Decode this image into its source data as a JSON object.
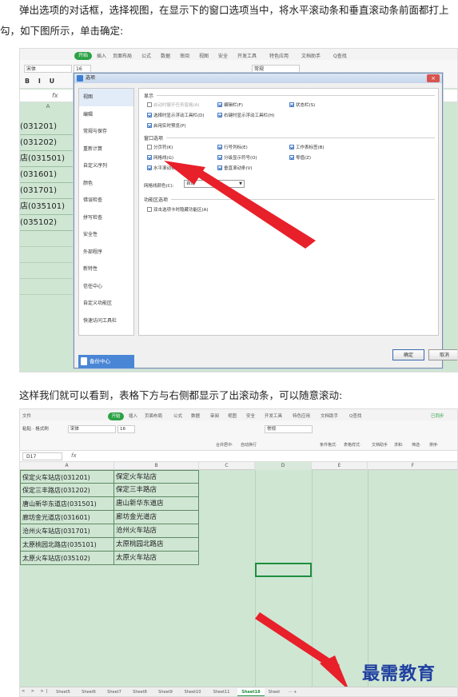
{
  "article": {
    "para1_line1": "弹出选项的对话框，选择视图，在显示下的窗口选项当中，将水平滚动条和垂直滚动条前面都打上",
    "para1_line2": "勾，如下图所示，单击确定:",
    "para2": "这样我们就可以看到，表格下方与右侧都显示了出滚动条，可以随意滚动:"
  },
  "shot1": {
    "menu": [
      "开始",
      "插入",
      "页面布局",
      "公式",
      "数据",
      "审阅",
      "视图",
      "安全",
      "开发工具",
      "特色应用",
      "文档助手",
      "Q查找"
    ],
    "font_name": "宋体",
    "font_size": "16",
    "style_select": "常规",
    "column_a": "A",
    "fx": "fx",
    "cells": [
      "(031201)",
      "(031202)",
      "店(031501)",
      "(031601)",
      "(031701)",
      "店(035101)",
      "(035102)"
    ],
    "dialog": {
      "title": "选项",
      "close": "×",
      "nav": [
        "视图",
        "编辑",
        "常规与保存",
        "重新计算",
        "自定义序列",
        "颜色",
        "错误检查",
        "拼写检查",
        "安全性",
        "外部程序",
        "新特性",
        "信任中心",
        "自定义功能区",
        "快速访问工具栏"
      ],
      "backup": "备份中心",
      "section_display": "显示",
      "opt_startup_taskpane": "启动时展开任务窗格(A)",
      "opt_formula_bar": "编辑栏(F)",
      "opt_status_bar": "状态栏(S)",
      "opt_float_toolbar_select": "选择时显示浮动工具栏(D)",
      "opt_float_toolbar_rightclick": "右键时显示浮动工具栏(H)",
      "opt_live_preview": "启用实时预览(P)",
      "section_window": "窗口选项",
      "opt_page_break": "分页符(K)",
      "opt_row_col_headers": "行号列标(E)",
      "opt_sheet_tabs": "工作表标签(B)",
      "opt_gridlines": "网格线(G)",
      "opt_outline_symbols": "分级显示符号(O)",
      "opt_zero_values": "零值(Z)",
      "opt_hscroll": "水平滚动条(T)",
      "opt_vscroll": "垂直滚动条(V)",
      "gridline_color_label": "网格线颜色(C):",
      "gridline_color_value": "自动",
      "section_ribbon": "功能区选项",
      "opt_dblclick_ribbon": "双击选项卡时隐藏功能区(A)",
      "ok": "确定",
      "cancel": "取消"
    }
  },
  "shot2": {
    "menu": [
      "文件",
      "开始",
      "插入",
      "页面布局",
      "公式",
      "数据",
      "审阅",
      "视图",
      "安全",
      "开发工具",
      "特色应用",
      "文档助手",
      "Q查找",
      "已同步"
    ],
    "paste_label": "粘贴 · 格式刷",
    "font_name": "宋体",
    "font_size": "16",
    "style_select": "常规",
    "ribbon_labels": [
      "合并居中·",
      "自动换行",
      "条件格式·",
      "表格样式·",
      "文档助手",
      "求和·",
      "筛选·",
      "排序·"
    ],
    "name_box": "D17",
    "fx": "fx",
    "columns": [
      "A",
      "B",
      "C",
      "D",
      "E",
      "F"
    ],
    "rows": [
      {
        "a": "保定火车站店(031201)",
        "b": "保定火车站店"
      },
      {
        "a": "保定三丰路店(031202)",
        "b": "保定三丰路店"
      },
      {
        "a": "唐山新华东道店(031501)",
        "b": "唐山新华东道店"
      },
      {
        "a": "廊坊金光道店(031601)",
        "b": "廊坊金光道店"
      },
      {
        "a": "沧州火车站店(031701)",
        "b": "沧州火车站店"
      },
      {
        "a": "太原桃园北路店(035101)",
        "b": "太原桃园北路店"
      },
      {
        "a": "太原火车站店(035102)",
        "b": "太原火车站店"
      }
    ],
    "sheet_nav": "< > >|",
    "sheets": [
      "Sheet5",
      "Sheet6",
      "Sheet7",
      "Sheet8",
      "Sheet9",
      "Sheet10",
      "Sheet11",
      "Sheet18",
      "Sheet",
      "··· +"
    ],
    "active_sheet": "Sheet18",
    "watermark": "最需教育"
  },
  "colors": {
    "sheet_bg": "#cfe6d3",
    "accent_green": "#2ba245",
    "arrow_red": "#e8202a",
    "watermark_blue": "#1f3fa0"
  }
}
